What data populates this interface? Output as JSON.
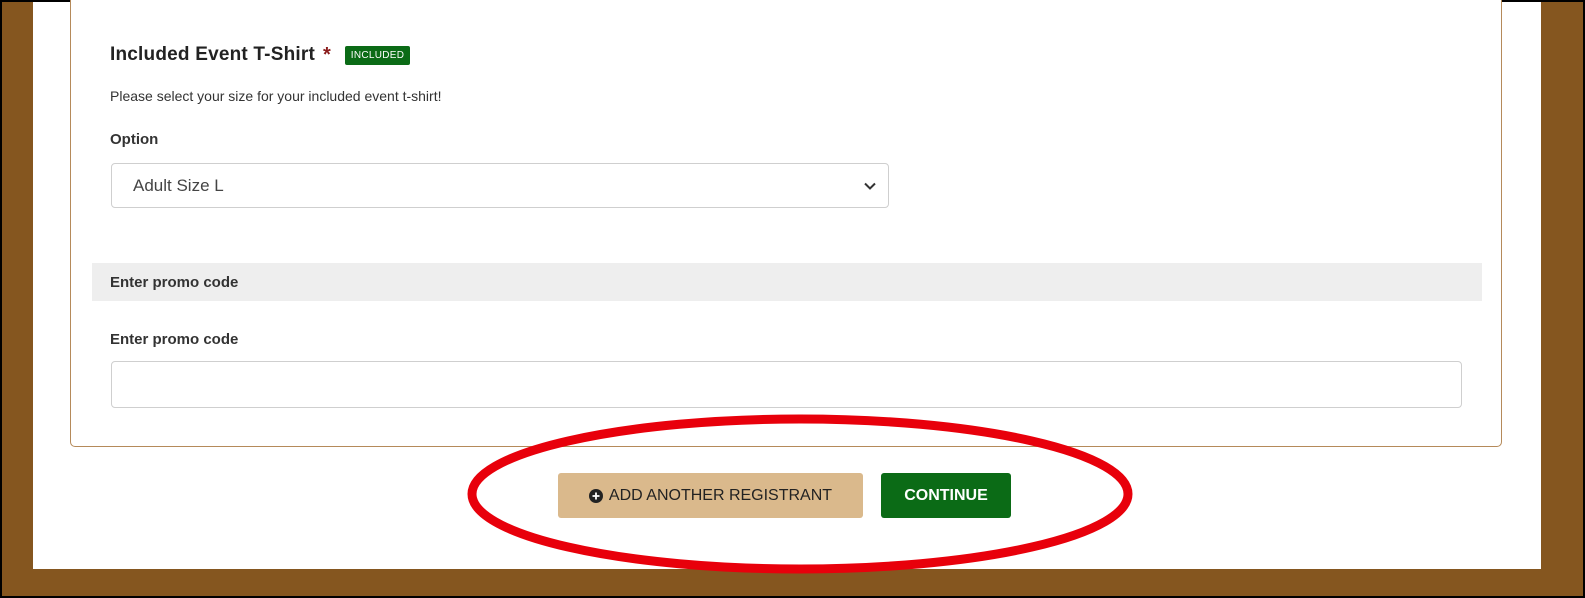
{
  "shirt": {
    "title": "Included Event T-Shirt",
    "required_mark": "*",
    "badge": "INCLUDED",
    "description": "Please select your size for your included event t-shirt!",
    "option_label": "Option",
    "selected_option": "Adult Size L"
  },
  "promo": {
    "section_title": "Enter promo code",
    "field_label": "Enter promo code",
    "value": "",
    "placeholder": ""
  },
  "actions": {
    "add_registrant": "ADD ANOTHER REGISTRANT",
    "continue": "CONTINUE"
  },
  "colors": {
    "frame_brown": "#85561f",
    "badge_green": "#0b6b16",
    "continue_green": "#0b6b16",
    "add_button_tan": "#dab98c",
    "annotation_red": "#e8000b",
    "required_red": "#8a1b1b"
  },
  "icons": {
    "select_arrow": "chevron-down-icon",
    "add_button": "plus-circle-icon"
  }
}
